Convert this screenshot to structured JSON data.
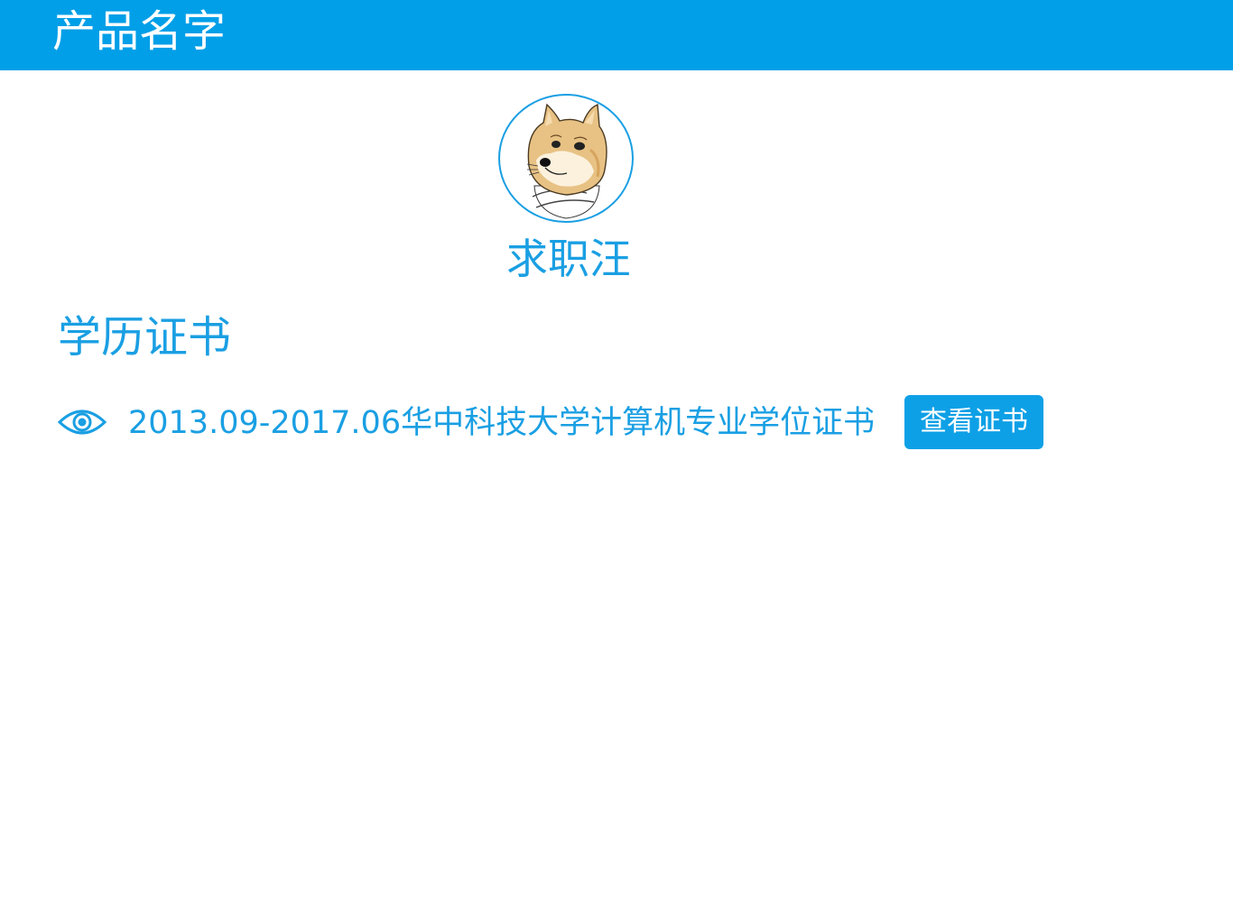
{
  "header": {
    "app_title": "产品名字"
  },
  "profile": {
    "avatar_icon": "doge-avatar-icon",
    "name": "求职汪"
  },
  "section": {
    "title": "学历证书"
  },
  "certificates": [
    {
      "icon": "eye-icon",
      "text": "2013.09-2017.06华中科技大学计算机专业学位证书",
      "button_label": "查看证书"
    }
  ],
  "colors": {
    "header_bg": "#009fe8",
    "accent": "#1a9fe3",
    "button_bg": "#0ea0e6",
    "background": "#ffffff"
  }
}
